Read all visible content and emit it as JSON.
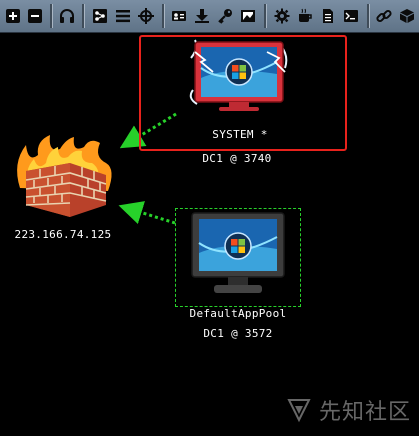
{
  "toolbar": {
    "buttons": [
      {
        "name": "add-icon"
      },
      {
        "name": "remove-icon"
      },
      {
        "name": "headphones-icon"
      },
      {
        "name": "pivot-graph-icon"
      },
      {
        "name": "list-icon"
      },
      {
        "name": "crosshair-icon"
      },
      {
        "name": "credentials-icon"
      },
      {
        "name": "download-icon"
      },
      {
        "name": "key-icon"
      },
      {
        "name": "screenshot-icon"
      },
      {
        "name": "gear-icon"
      },
      {
        "name": "coffee-icon"
      },
      {
        "name": "document-icon"
      },
      {
        "name": "terminal-icon"
      },
      {
        "name": "link-icon"
      },
      {
        "name": "cube-icon"
      }
    ]
  },
  "nodes": {
    "firewall": {
      "label": "223.166.74.125"
    },
    "system": {
      "user": "SYSTEM *",
      "host": "DC1 @ 3740"
    },
    "apppool": {
      "user": "DefaultAppPool",
      "host": "DC1 @ 3572"
    }
  },
  "colors": {
    "selection": "#e8221c",
    "link_arrow": "#27d12a",
    "toolbar_bg": "#6b7f94"
  },
  "watermark": {
    "text": "先知社区"
  }
}
